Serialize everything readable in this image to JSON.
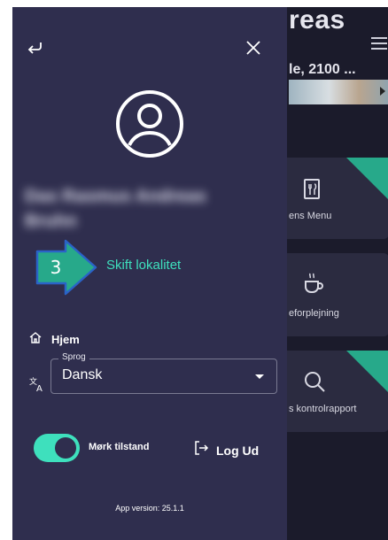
{
  "background": {
    "title": "reas",
    "address": "le, 2100 ...",
    "cards": [
      {
        "label": "ens Menu",
        "icon": "menu-book-icon"
      },
      {
        "label": "eforplejning",
        "icon": "coffee-cup-icon"
      },
      {
        "label": "s kontrolrapport",
        "icon": "search-icon"
      }
    ]
  },
  "drawer": {
    "user_name": "Das Rasmus Andreas Bruhn",
    "callout_number": "3",
    "switch_location": "Skift lokalitet",
    "home_label": "Hjem",
    "language": {
      "legend": "Sprog",
      "value": "Dansk"
    },
    "dark_mode_label": "Mørk tilstand",
    "dark_mode_on": true,
    "logout_label": "Log Ud",
    "app_version": "App version: 25.1.1"
  },
  "colors": {
    "drawer_bg": "#2f2e4e",
    "accent": "#3ee0bd",
    "callout": "#27a98a"
  }
}
